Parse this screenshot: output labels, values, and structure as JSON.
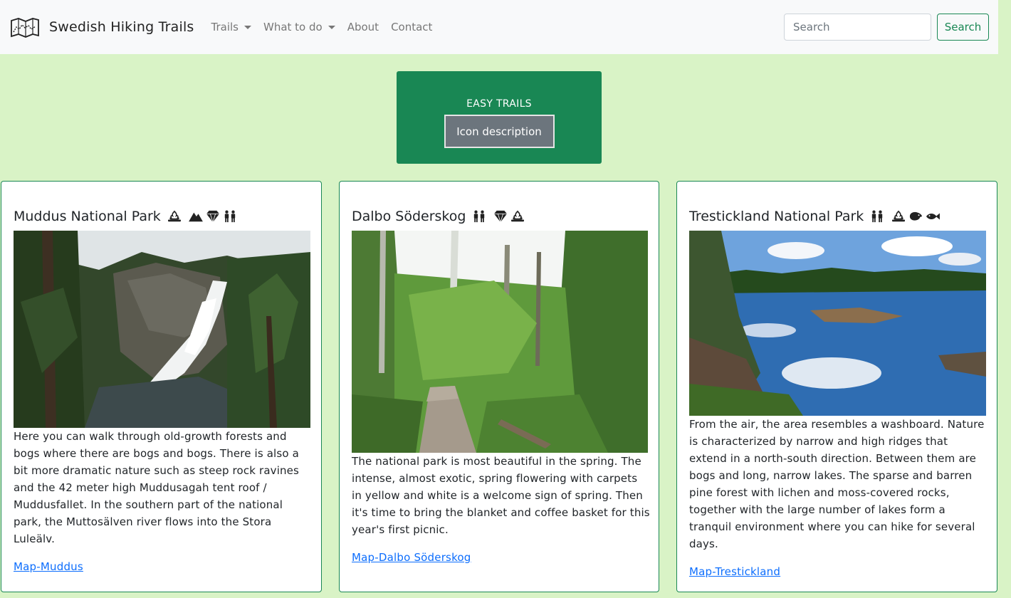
{
  "brand": {
    "name": "Swedish Hiking Trails",
    "logo_icon": "map-icon"
  },
  "nav": {
    "items": [
      {
        "label": "Trails",
        "dropdown": true
      },
      {
        "label": "What to do",
        "dropdown": true
      },
      {
        "label": "About",
        "dropdown": false
      },
      {
        "label": "Contact",
        "dropdown": false
      }
    ]
  },
  "search": {
    "placeholder": "Search",
    "button_label": "Search"
  },
  "banner": {
    "title": "EASY TRAILS",
    "button_label": "Icon description"
  },
  "colors": {
    "background": "#d9f3c6",
    "accent": "#198754",
    "link": "#0d6efd",
    "navbar": "#f8f9fa"
  },
  "cards": [
    {
      "title": "Muddus National Park",
      "icons": [
        "campfire-icon",
        "mountain-icon",
        "diamond-icon",
        "family-icon"
      ],
      "image": "waterfall-photo",
      "text": "Here you can walk through old-growth forests and bogs where there are bogs and bogs. There is also a bit more dramatic nature such as steep rock ravines and the 42 meter high Muddusagah tent roof / Muddusfallet. In the southern part of the national park, the Muttosälven river flows into the Stora Luleälv.",
      "link": "Map-Muddus"
    },
    {
      "title": "Dalbo Söderskog",
      "icons": [
        "family-icon",
        "diamond-icon",
        "campfire-icon"
      ],
      "image": "forest-path-photo",
      "text": "The national park is most beautiful in the spring. The intense, almost exotic, spring flowering with carpets in yellow and white is a welcome sign of spring. Then it's time to bring the blanket and coffee basket for this year's first picnic.",
      "link": "Map-Dalbo Söderskog"
    },
    {
      "title": "Trestickland National Park",
      "icons": [
        "family-icon",
        "campfire-icon",
        "bird-icon",
        "fish-icon"
      ],
      "image": "lake-photo",
      "text": "From the air, the area resembles a washboard. Nature is characterized by narrow and high ridges that extend in a north-south direction. Between them are bogs and long, narrow lakes. The sparse and barren pine forest with lichen and moss-covered rocks, together with the large number of lakes form a tranquil environment where you can hike for several days.",
      "link": "Map-Trestickland"
    }
  ]
}
